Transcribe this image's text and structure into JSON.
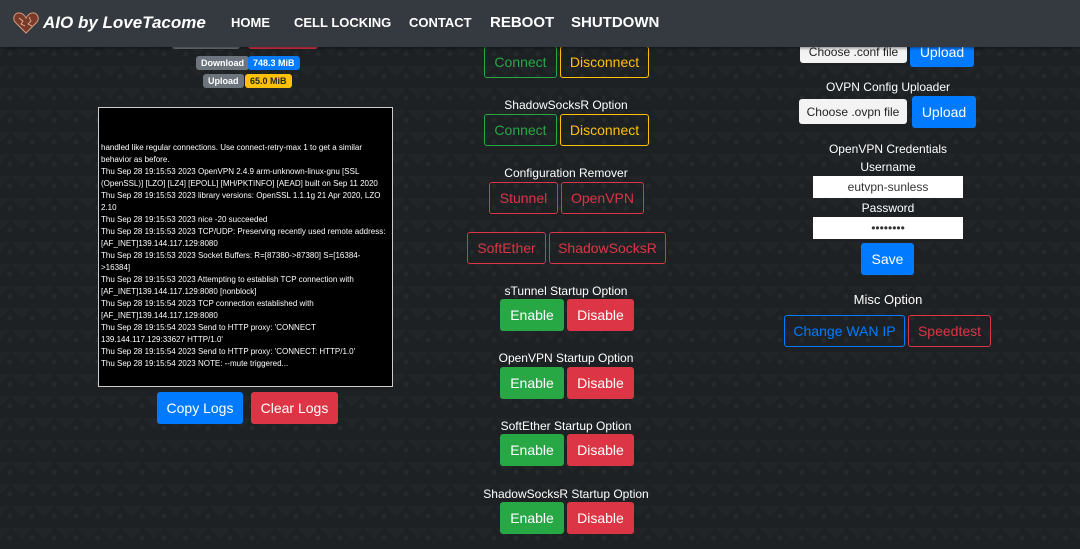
{
  "nav": {
    "brand": "AIO by LoveTacome",
    "items": [
      "HOME",
      "CELL LOCKING",
      "CONTACT",
      "REBOOT",
      "SHUTDOWN"
    ]
  },
  "stats": {
    "download_label": "Download",
    "download_value": "748.3 MiB",
    "upload_label": "Upload",
    "upload_value": "65.0 MiB"
  },
  "logs": {
    "lines": [
      "handled like regular connections. Use connect-retry-max 1 to get a similar behavior as before.",
      "Thu Sep 28 19:15:53 2023 OpenVPN 2.4.9 arm-unknown-linux-gnu [SSL (OpenSSL)] [LZO] [LZ4] [EPOLL] [MH/PKTINFO] [AEAD] built on Sep 11 2020",
      "Thu Sep 28 19:15:53 2023 library versions: OpenSSL 1.1.1g  21 Apr 2020, LZO 2.10",
      "Thu Sep 28 19:15:53 2023 nice -20 succeeded",
      "Thu Sep 28 19:15:53 2023 TCP/UDP: Preserving recently used remote address: [AF_INET]139.144.117.129:8080",
      "Thu Sep 28 19:15:53 2023 Socket Buffers: R=[87380->87380] S=[16384->16384]",
      "Thu Sep 28 19:15:53 2023 Attempting to establish TCP connection with [AF_INET]139.144.117.129:8080 [nonblock]",
      "Thu Sep 28 19:15:54 2023 TCP connection established with [AF_INET]139.144.117.129:8080",
      "Thu Sep 28 19:15:54 2023 Send to HTTP proxy: 'CONNECT 139.144.117.129:33627 HTTP/1.0'",
      "Thu Sep 28 19:15:54 2023 Send to HTTP proxy: 'CONNECT: HTTP/1.0'",
      "Thu Sep 28 19:15:54 2023 NOTE: --mute triggered..."
    ],
    "copy_label": "Copy Logs",
    "clear_label": "Clear Logs"
  },
  "middle": {
    "vpn_connect": "Connect",
    "vpn_disconnect": "Disconnect",
    "ssr_title": "ShadowSocksR Option",
    "ssr_connect": "Connect",
    "ssr_disconnect": "Disconnect",
    "remover_title": "Configuration Remover",
    "remove_stunnel": "Stunnel",
    "remove_openvpn": "OpenVPN",
    "remove_softether": "SoftEther",
    "remove_shadowsocksr": "ShadowSocksR",
    "startup": [
      {
        "title": "sTunnel Startup Option",
        "enable": "Enable",
        "disable": "Disable"
      },
      {
        "title": "OpenVPN Startup Option",
        "enable": "Enable",
        "disable": "Disable"
      },
      {
        "title": "SoftEther Startup Option",
        "enable": "Enable",
        "disable": "Disable"
      },
      {
        "title": "ShadowSocksR Startup Option",
        "enable": "Enable",
        "disable": "Disable"
      }
    ]
  },
  "right": {
    "conf_choose": "Choose .conf file",
    "conf_upload": "Upload",
    "ovpn_title": "OVPN Config Uploader",
    "ovpn_choose": "Choose .ovpn file",
    "ovpn_upload": "Upload",
    "cred_title": "OpenVPN Credentials",
    "username_label": "Username",
    "username_value": "eutvpn-sunless",
    "password_label": "Password",
    "password_value": "••••••••",
    "save_label": "Save",
    "misc_title": "Misc Option",
    "change_wan": "Change WAN IP",
    "speedtest": "Speedtest"
  },
  "colors": {
    "navbar": "#343a40",
    "primary": "#007bff",
    "danger": "#dc3545",
    "success": "#28a745",
    "warning": "#ffc107"
  }
}
